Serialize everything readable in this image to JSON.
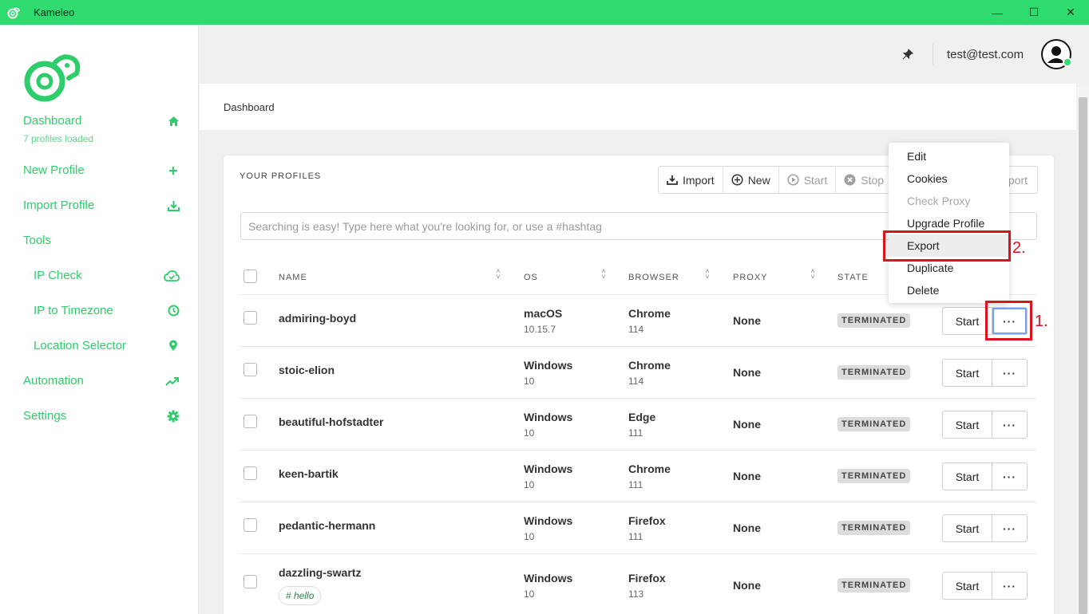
{
  "window": {
    "title": "Kameleo"
  },
  "sidebar": {
    "dashboard": {
      "label": "Dashboard",
      "caption": "7 profiles loaded"
    },
    "items": [
      {
        "label": "New Profile",
        "icon": "plus-icon"
      },
      {
        "label": "Import Profile",
        "icon": "import-icon"
      },
      {
        "label": "Tools"
      },
      {
        "label": "IP Check",
        "icon": "cloud-check-icon"
      },
      {
        "label": "IP to Timezone",
        "icon": "clock-icon"
      },
      {
        "label": "Location Selector",
        "icon": "location-pin-icon"
      },
      {
        "label": "Automation",
        "icon": "trend-icon"
      },
      {
        "label": "Settings",
        "icon": "gear-icon"
      }
    ]
  },
  "header": {
    "user_email": "test@test.com"
  },
  "breadcrumb": "Dashboard",
  "profiles": {
    "title": "YOUR PROFILES",
    "toolbar": {
      "import": "Import",
      "new": "New",
      "start": "Start",
      "stop": "Stop",
      "export_partial": "port"
    },
    "search_placeholder": "Searching is easy! Type here what you're looking for, or use a #hashtag",
    "columns": {
      "name": "NAME",
      "os": "OS",
      "browser": "BROWSER",
      "proxy": "PROXY",
      "state": "STATE"
    },
    "rows": [
      {
        "name": "admiring-boyd",
        "os": "macOS",
        "os_version": "10.15.7",
        "browser": "Chrome",
        "browser_version": "114",
        "proxy": "None",
        "state": "TERMINATED"
      },
      {
        "name": "stoic-elion",
        "os": "Windows",
        "os_version": "10",
        "browser": "Chrome",
        "browser_version": "114",
        "proxy": "None",
        "state": "TERMINATED"
      },
      {
        "name": "beautiful-hofstadter",
        "os": "Windows",
        "os_version": "10",
        "browser": "Edge",
        "browser_version": "111",
        "proxy": "None",
        "state": "TERMINATED"
      },
      {
        "name": "keen-bartik",
        "os": "Windows",
        "os_version": "10",
        "browser": "Chrome",
        "browser_version": "111",
        "proxy": "None",
        "state": "TERMINATED"
      },
      {
        "name": "pedantic-hermann",
        "os": "Windows",
        "os_version": "10",
        "browser": "Firefox",
        "browser_version": "111",
        "proxy": "None",
        "state": "TERMINATED"
      },
      {
        "name": "dazzling-swartz",
        "tag": "# hello",
        "os": "Windows",
        "os_version": "10",
        "browser": "Firefox",
        "browser_version": "113",
        "proxy": "None",
        "state": "TERMINATED"
      }
    ],
    "row_button": "Start",
    "more_button": "···"
  },
  "menu": {
    "items": [
      "Edit",
      "Cookies",
      "Check Proxy",
      "Upgrade Profile",
      "Export",
      "Duplicate",
      "Delete"
    ],
    "disabled": "Check Proxy",
    "highlighted": "Export"
  },
  "annotations": {
    "step1": "1.",
    "step2": "2."
  },
  "colors": {
    "accent": "#2edb6f",
    "annotation": "#d9141f"
  }
}
